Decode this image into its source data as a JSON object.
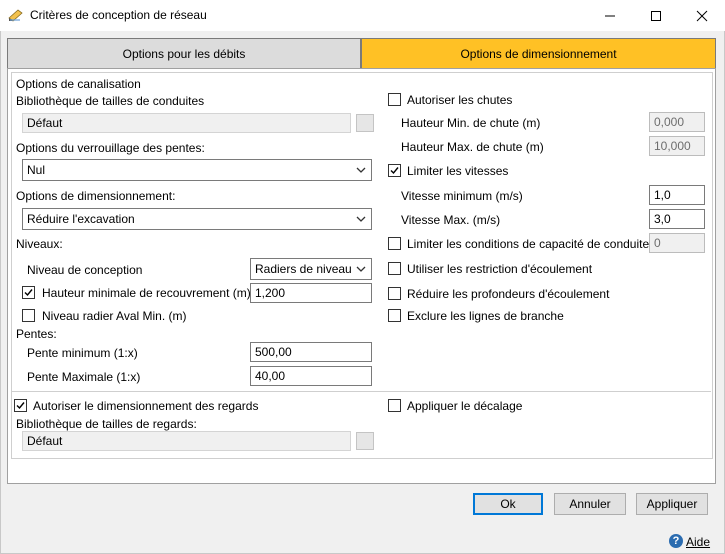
{
  "window": {
    "title": "Critères de conception de réseau"
  },
  "tabs": [
    {
      "label": "Options pour les débits",
      "active": false
    },
    {
      "label": "Options de dimensionnement",
      "active": true
    }
  ],
  "colors": {
    "active_tab": "#ffc125",
    "inactive_tab": "#dcdcdc"
  },
  "left": {
    "pipe_options_label": "Options de canalisation",
    "pipe_library_label": "Bibliothèque de tailles de conduites",
    "pipe_library_value": "Défaut",
    "slope_lock_label": "Options du verrouillage des pentes:",
    "slope_lock_value": "Nul",
    "sizing_options_label": "Options de dimensionnement:",
    "sizing_options_value": "Réduire l'excavation",
    "levels_label": "Niveaux:",
    "design_level_label": "Niveau de conception",
    "design_level_value": "Radiers de niveau",
    "min_cover_label": "Hauteur minimale de recouvrement (m)",
    "min_cover_checked": true,
    "min_cover_value": "1,200",
    "min_invert_label": "Niveau radier Aval Min. (m)",
    "min_invert_checked": false,
    "slopes_label": "Pentes:",
    "min_slope_label": "Pente minimum (1:x)",
    "min_slope_value": "500,00",
    "max_slope_label": "Pente Maximale (1:x)",
    "max_slope_value": "40,00"
  },
  "right": {
    "allow_drops_label": "Autoriser les chutes",
    "allow_drops_checked": false,
    "min_drop_label": "Hauteur Min. de chute (m)",
    "min_drop_value": "0,000",
    "max_drop_label": "Hauteur Max. de chute (m)",
    "max_drop_value": "10,000",
    "limit_velocity_label": "Limiter les vitesses",
    "limit_velocity_checked": true,
    "min_velocity_label": "Vitesse minimum (m/s)",
    "min_velocity_value": "1,0",
    "max_velocity_label": "Vitesse Max. (m/s)",
    "max_velocity_value": "3,0",
    "limit_capacity_label": "Limiter les conditions de capacité de conduite (%)",
    "limit_capacity_checked": false,
    "limit_capacity_value": "0",
    "use_flow_restriction_label": "Utiliser les restriction d'écoulement",
    "use_flow_restriction_checked": false,
    "reduce_flow_depth_label": "Réduire les profondeurs d'écoulement",
    "reduce_flow_depth_checked": false,
    "exclude_branch_label": "Exclure les lignes de branche",
    "exclude_branch_checked": false
  },
  "bottom": {
    "allow_manhole_sizing_label": "Autoriser le dimensionnement des regards",
    "allow_manhole_sizing_checked": true,
    "manhole_library_label": "Bibliothèque de tailles de regards:",
    "manhole_library_value": "Défaut",
    "apply_offset_label": "Appliquer le décalage",
    "apply_offset_checked": false
  },
  "buttons": {
    "ok": "Ok",
    "cancel": "Annuler",
    "apply": "Appliquer"
  },
  "help": {
    "icon_text": "?",
    "label": "Aide"
  }
}
